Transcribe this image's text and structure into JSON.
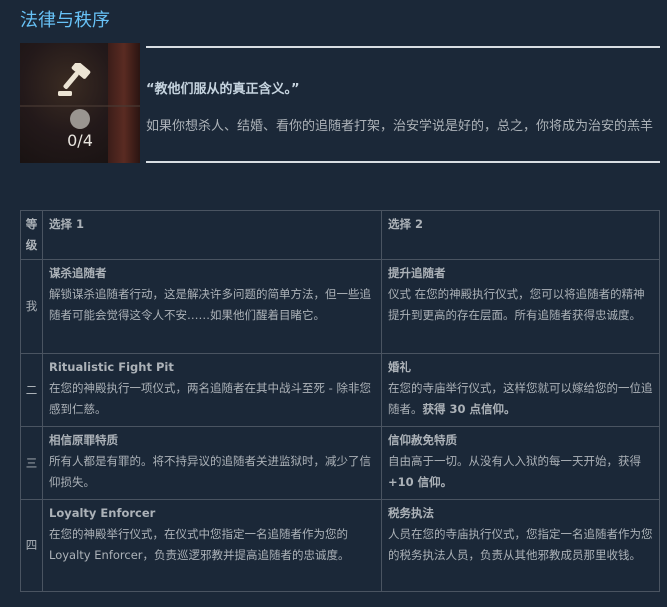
{
  "section_title": "法律与秩序",
  "banner": {
    "icon": "gavel-icon",
    "progress_text": "0/4",
    "quote": "“教他们服从的真正含义。”",
    "description": "如果你想杀人、结婚、看你的追随者打架，治安学说是好的，总之，你将成为治安的羔羊"
  },
  "table": {
    "headers": [
      "等级",
      "选择 1",
      "选择 2"
    ],
    "rows": [
      {
        "level": "我",
        "opt1": {
          "title": "谋杀追随者",
          "desc": "解锁谋杀追随者行动，这是解决许多问题的简单方法，但一些追随者可能会觉得这令人不安……如果他们醒着目睹它。",
          "bold": ""
        },
        "opt2": {
          "title": "提升追随者",
          "desc": "仪式 在您的神殿执行仪式，您可以将追随者的精神提升到更高的存在层面。所有追随者获得忠诚度。",
          "bold": ""
        }
      },
      {
        "level": "二",
        "opt1": {
          "title": "Ritualistic Fight Pit",
          "desc": "在您的神殿执行一项仪式，两名追随者在其中战斗至死 - 除非您感到仁慈。",
          "bold": ""
        },
        "opt2": {
          "title": "婚礼",
          "desc": "在您的寺庙举行仪式，这样您就可以嫁给您的一位追随者。",
          "bold": "获得 30 点信仰。"
        }
      },
      {
        "level": "三",
        "opt1": {
          "title": "相信原罪特质",
          "desc": "所有人都是有罪的。将不持异议的追随者关进监狱时，减少了信仰损失。",
          "bold": ""
        },
        "opt2": {
          "title": "信仰赦免特质",
          "desc": "自由高于一切。从没有人入狱的每一天开始，获得",
          "bold": "+10 信仰。"
        }
      },
      {
        "level": "四",
        "opt1": {
          "title": "Loyalty Enforcer",
          "desc": "在您的神殿举行仪式，在仪式中您指定一名追随者作为您的 Loyalty Enforcer，负责巡逻邪教并提高追随者的忠诚度。",
          "bold": ""
        },
        "opt2": {
          "title": "税务执法",
          "desc": "人员在您的寺庙执行仪式，您指定一名追随者作为您的税务执法人员，负责从其他邪教成员那里收钱。",
          "bold": ""
        }
      }
    ]
  }
}
